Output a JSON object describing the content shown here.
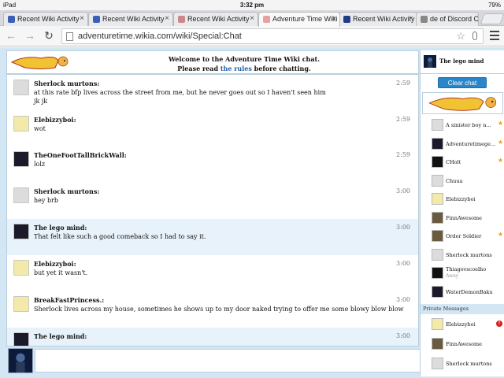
{
  "status_bar": {
    "device": "iPad",
    "time": "3:32 pm",
    "battery": "79%"
  },
  "tabs": [
    {
      "label": "Recent Wiki Activity",
      "active": false,
      "color": "#3b5fb8"
    },
    {
      "label": "Recent Wiki Activity",
      "active": false,
      "color": "#3b5fb8"
    },
    {
      "label": "Recent Wiki Activity",
      "active": false,
      "color": "#c88"
    },
    {
      "label": "Adventure Time Wiki",
      "active": true,
      "color": "#e8a0a0"
    },
    {
      "label": "Recent Wiki Activity",
      "active": false,
      "color": "#223a8a"
    },
    {
      "label": "de of Discord Ch",
      "active": false,
      "color": "#888"
    }
  ],
  "address_bar": {
    "url": "adventuretime.wikia.com/wiki/Special:Chat"
  },
  "chat_header": {
    "welcome_line": "Welcome to the Adventure Time Wiki chat.",
    "rules_prefix": "Please read ",
    "rules_link": "the rules",
    "rules_suffix": " before chatting."
  },
  "messages": [
    {
      "user": "Sherlock murtons:",
      "time": "2:59",
      "lines": [
        "at this rate bfp lives across the street from me, but he never goes out so I haven't seen him",
        "jk jk"
      ],
      "self": false,
      "avatar": "grey"
    },
    {
      "user": "Elebizzyboi:",
      "time": "2:59",
      "lines": [
        "wot"
      ],
      "self": false,
      "avatar": "yellow"
    },
    {
      "user": "TheOneFootTallBrickWall:",
      "time": "2:59",
      "lines": [
        "lolz"
      ],
      "self": false,
      "avatar": "dark"
    },
    {
      "user": "Sherlock murtons:",
      "time": "3:00",
      "lines": [
        "hey brb"
      ],
      "self": false,
      "avatar": "grey"
    },
    {
      "user": "The lego mind:",
      "time": "3:00",
      "lines": [
        "That felt like such a good comeback so I had to say it."
      ],
      "self": true,
      "avatar": "dark"
    },
    {
      "user": "Elebizzyboi:",
      "time": "3:00",
      "lines": [
        "but yet it wasn't."
      ],
      "self": false,
      "avatar": "yellow"
    },
    {
      "user": "BreakFastPrincess.:",
      "time": "3:00",
      "lines": [
        "Sherlock lives across my house, sometimes he shows up to my door naked trying to offer me some blowy blow blow"
      ],
      "self": false,
      "avatar": "yellow"
    },
    {
      "user": "The lego mind:",
      "time": "3:00",
      "lines": [
        ""
      ],
      "self": true,
      "avatar": "dark"
    }
  ],
  "sidebar": {
    "current_user": "The lego mind",
    "clear_chat_label": "Clear chat",
    "users": [
      {
        "name": "A sinister boy n...",
        "status": "",
        "staff": true,
        "avatar": "grey"
      },
      {
        "name": "Adventuretimege...",
        "status": "",
        "staff": true,
        "avatar": "dark"
      },
      {
        "name": "CHolt",
        "status": "",
        "staff": true,
        "avatar": "black"
      },
      {
        "name": "Chuua",
        "status": "",
        "staff": false,
        "avatar": "grey"
      },
      {
        "name": "Elebizzyboi",
        "status": "",
        "staff": false,
        "avatar": "yellow"
      },
      {
        "name": "FinnAwesome",
        "status": "",
        "staff": false,
        "avatar": "brown"
      },
      {
        "name": "Order Soldier",
        "status": "",
        "staff": true,
        "avatar": "brown"
      },
      {
        "name": "Sherlock murtons",
        "status": "",
        "staff": false,
        "avatar": "grey"
      },
      {
        "name": "Thiagovscoelho",
        "status": "Away",
        "staff": false,
        "avatar": "black"
      },
      {
        "name": "WaterDemonBaku",
        "status": "",
        "staff": false,
        "avatar": "dark"
      }
    ],
    "private_messages_label": "Private Messages",
    "private_messages": [
      {
        "name": "Elebizzyboi",
        "unread": "!",
        "avatar": "yellow"
      },
      {
        "name": "FinnAwesome",
        "unread": "",
        "avatar": "brown"
      },
      {
        "name": "Sherlock murtons",
        "unread": "",
        "avatar": "grey"
      }
    ]
  },
  "colors": {
    "page_bg": "#d3e6f3",
    "link": "#1e5fa5",
    "button": "#2a86c9",
    "staff_star": "#f0a020",
    "self_msg_bg": "#e8f2fa"
  },
  "icons": [
    "back-icon",
    "forward-icon",
    "reload-icon",
    "bookmark-star-icon",
    "mic-icon",
    "menu-icon",
    "staff-star-icon",
    "tab-close-icon"
  ]
}
